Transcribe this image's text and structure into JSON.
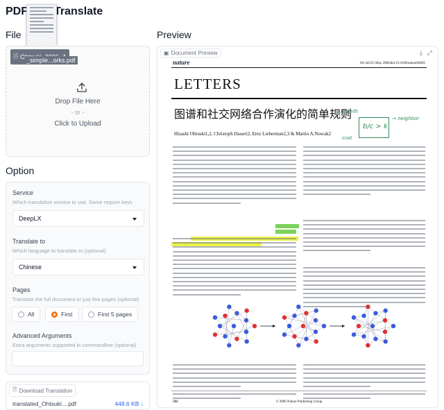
{
  "app": {
    "title": "PDFMathTranslate",
    "title_visible_left": "PDF",
    "title_visible_right": "Translate"
  },
  "file_section": {
    "title": "File",
    "uploaded_chip_line1": "Ohtsuki_2006_A",
    "uploaded_chip_line2": "_simple...orks.pdf",
    "drop_text": "Drop File Here",
    "or_text": "- or -",
    "click_text": "Click to Upload"
  },
  "option_section": {
    "title": "Option",
    "service": {
      "label": "Service",
      "hint": "Which translation service to use. Some require keys",
      "value": "DeepLX"
    },
    "translate_to": {
      "label": "Translate to",
      "hint": "Which language to translate to (optional)",
      "value": "Chinese"
    },
    "pages": {
      "label": "Pages",
      "hint": "Translate the full document or just few pages (optional)",
      "options": [
        "All",
        "First",
        "First 5 pages"
      ],
      "selected": "First"
    },
    "advanced": {
      "label": "Advanced Arguments",
      "hint": "Extra arguments supported in commandline (optional)",
      "value": ""
    }
  },
  "download": {
    "tab_label": "Download Translation",
    "file_name": "translated_Ohtsuki...",
    "file_ext": ".pdf",
    "file_size": "448.6 KB"
  },
  "preview": {
    "title": "Preview",
    "tab_label": "Document Preview",
    "doc": {
      "journal": "nature",
      "header_right": "Vol 441|25 May 2006|doi:10.1038/nature04605",
      "section": "LETTERS",
      "title": "图谱和社交网络合作演化的简单规则",
      "authors": "Hisashi Ohtsuki1,2, Christoph Hauert2, Erez Lieberman2,3 & Martin A.Nowak2",
      "hand_note_1": "b/c > k",
      "hand_note_2": "benefit",
      "hand_note_3": "cost",
      "hand_note_4": "→ neighbor",
      "page_number": "502",
      "footer": "© 2006 Nature Publishing Group"
    }
  },
  "colors": {
    "accent": "#f97316",
    "link": "#2563eb",
    "highlight_yellow": "#eaf24a",
    "highlight_green": "#7bd35a",
    "handwriting": "#2e8b57"
  }
}
